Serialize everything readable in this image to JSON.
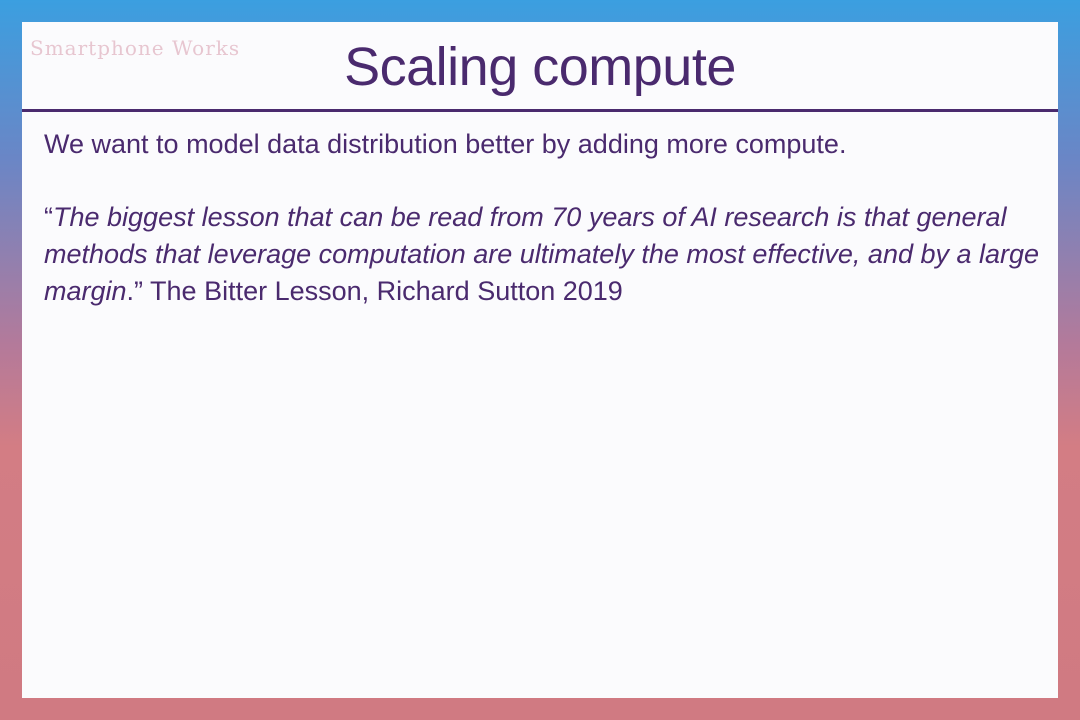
{
  "slide": {
    "watermark": "Smartphone Works",
    "title": "Scaling compute",
    "intro": "We want to model data distribution better by adding more compute.",
    "quote": {
      "open_mark": "“",
      "italic_text": "The biggest lesson that can be read from 70 years of AI research is that general methods that leverage computation are ultimately the most effective, and by a large margin",
      "close_mark": ".”",
      "attribution": " The Bitter Lesson, Richard Sutton 2019"
    }
  },
  "colors": {
    "text": "#4a2a6e",
    "slide_background": "#fbfbfd",
    "frame_top": "#3b9fe0",
    "frame_bottom": "#d07a82"
  }
}
